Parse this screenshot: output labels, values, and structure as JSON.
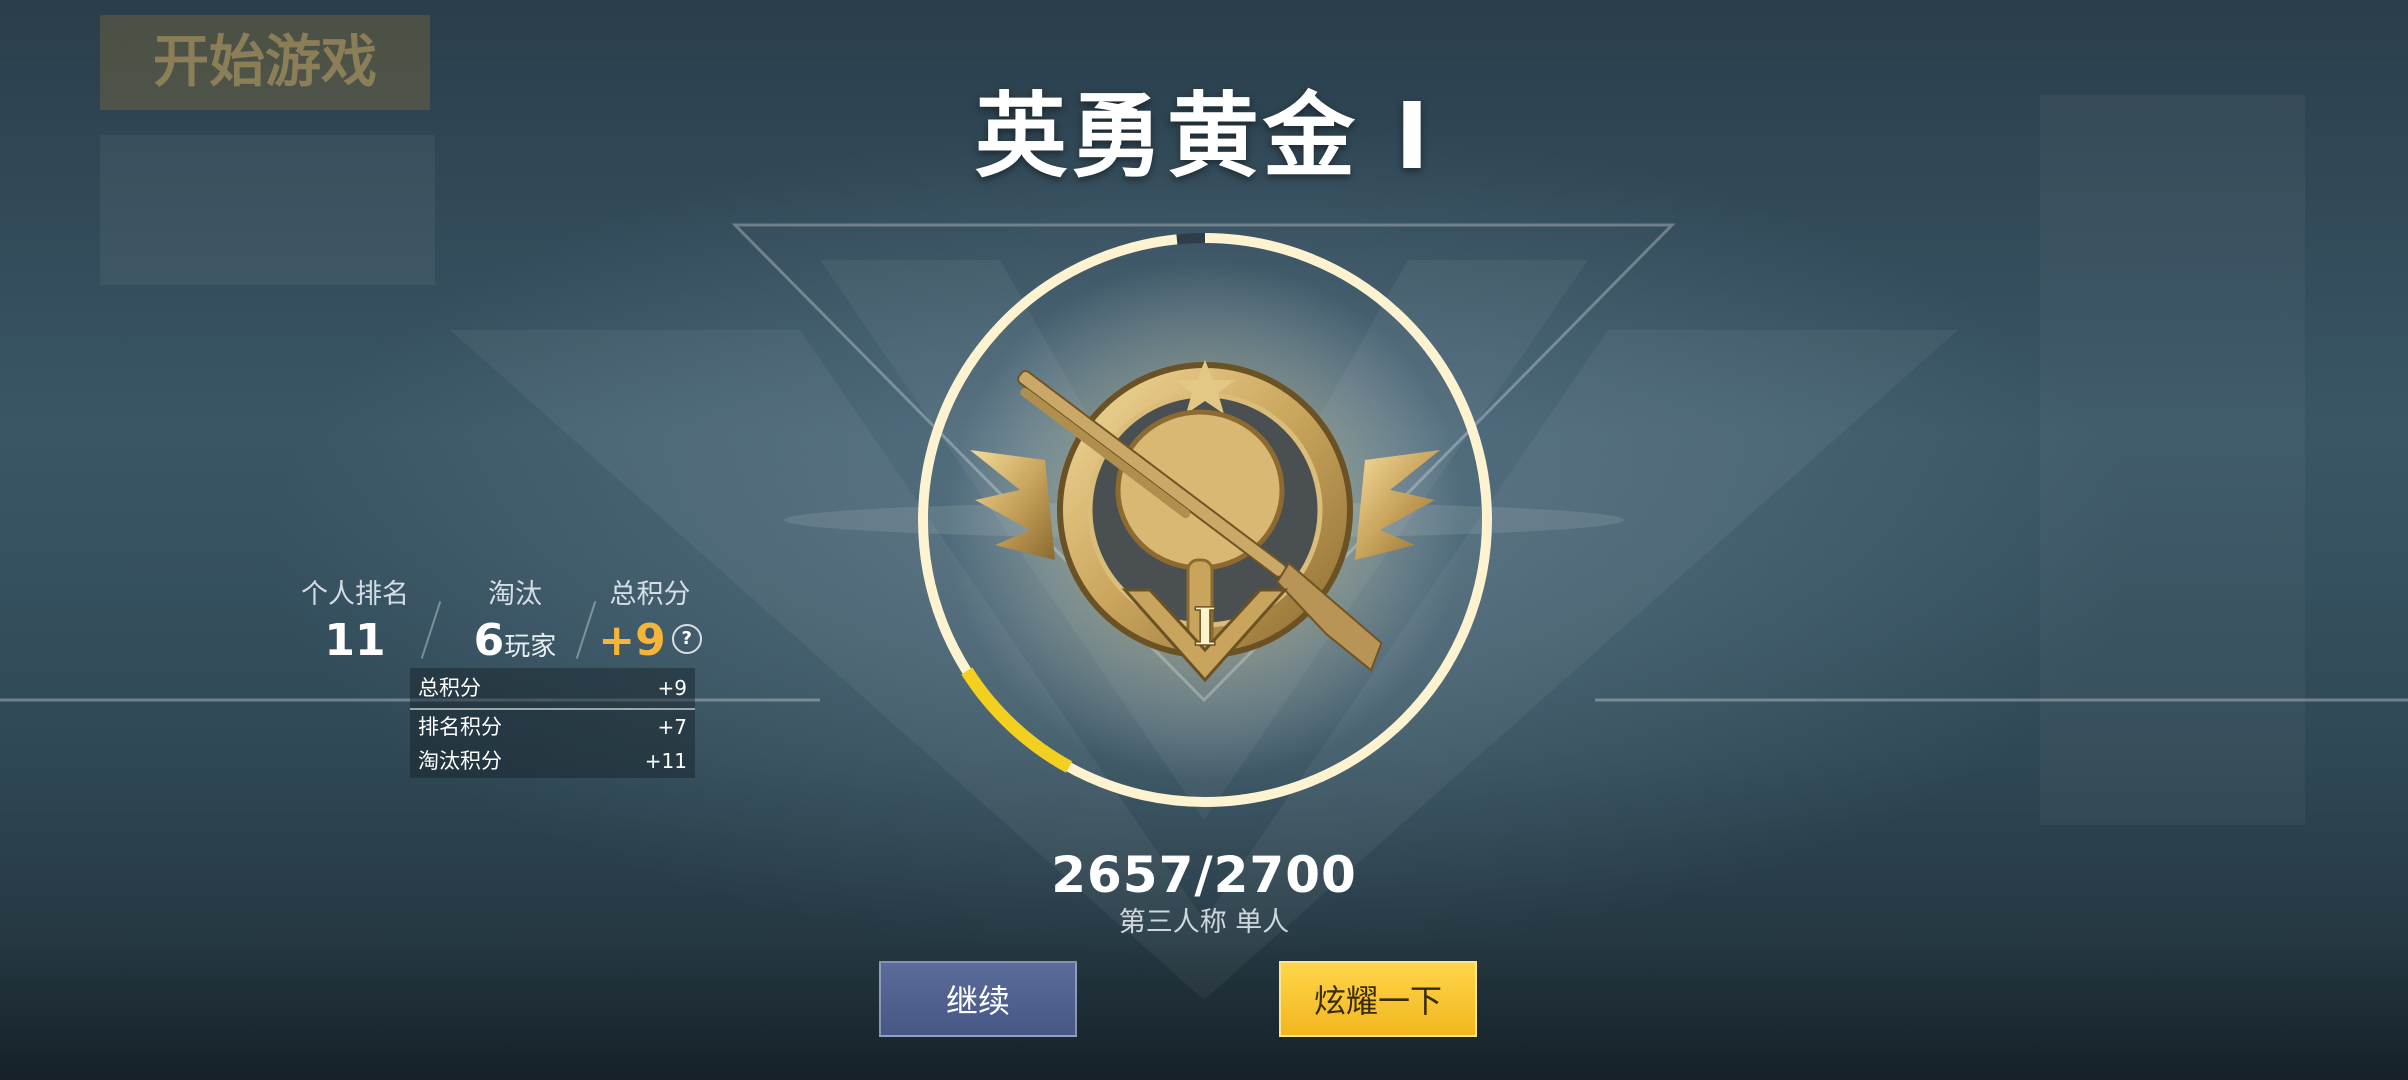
{
  "header": {
    "rank_name": "英勇黄金 Ⅰ"
  },
  "badge": {
    "tier_numeral": "Ⅰ"
  },
  "progress": {
    "current": 2657,
    "target": 2700,
    "label": "2657/2700",
    "fraction": 0.984
  },
  "mode": {
    "label": "第三人称 单人"
  },
  "stats": {
    "rank": {
      "label": "个人排名",
      "value": "11"
    },
    "eliminations": {
      "label": "淘汰",
      "value": "6",
      "unit": "玩家"
    },
    "total": {
      "label": "总积分",
      "value": "+9"
    }
  },
  "score_breakdown": {
    "header": {
      "label": "总积分",
      "value": "+9"
    },
    "rows": [
      {
        "label": "排名积分",
        "value": "+7"
      },
      {
        "label": "淘汰积分",
        "value": "+11"
      }
    ]
  },
  "buttons": {
    "continue": "继续",
    "share": "炫耀一下"
  },
  "background": {
    "start_game": "开始游戏"
  },
  "colors": {
    "gold": "#f5b43a",
    "button_blue": "#4f6090",
    "button_yellow": "#f5c52c"
  }
}
